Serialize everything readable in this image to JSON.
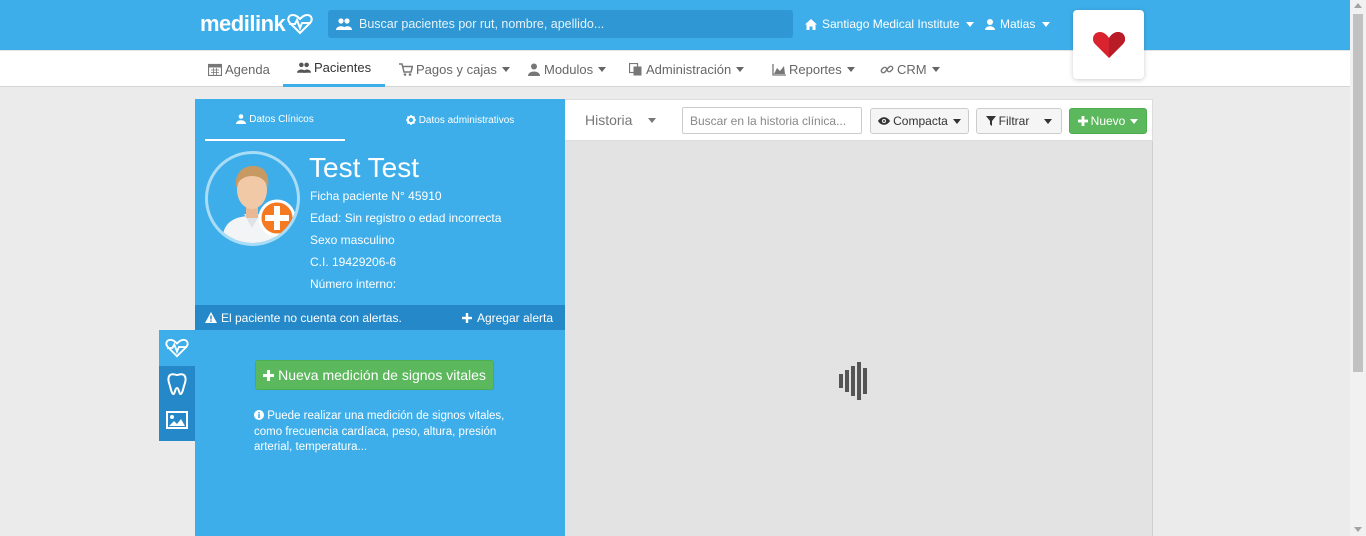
{
  "app": {
    "logo_text": "medilink",
    "search_placeholder": "Buscar pacientes por rut, nombre, apellido...",
    "clinic_name": "Santiago Medical Institute",
    "user_name": "Matias"
  },
  "nav": {
    "items": [
      {
        "label": "Agenda",
        "icon": "calendar-icon"
      },
      {
        "label": "Pacientes",
        "icon": "users-icon",
        "active": true
      },
      {
        "label": "Pagos y cajas",
        "icon": "cart-icon"
      },
      {
        "label": "Modulos",
        "icon": "user-md-icon"
      },
      {
        "label": "Administración",
        "icon": "copy-icon"
      },
      {
        "label": "Reportes",
        "icon": "area-chart-icon"
      },
      {
        "label": "CRM",
        "icon": "link-icon"
      }
    ]
  },
  "patient": {
    "tabs": {
      "clinical": "Datos Clínicos",
      "admin": "Datos administrativos"
    },
    "name": "Test Test",
    "record": "Ficha paciente N° 45910",
    "age": "Edad: Sin registro o edad incorrecta",
    "sex": "Sexo masculino",
    "id": "C.I. 19429206-6",
    "internal_number": "Número interno:",
    "alert_text": "El paciente no cuenta con alertas.",
    "add_alert": "Agregar alerta",
    "vitals_button": "Nueva medición de signos vitales",
    "vitals_info": "Puede realizar una medición de signos vitales, como frecuencia cardíaca, peso, altura, presión arterial, temperatura..."
  },
  "history": {
    "title": "Historia",
    "search_placeholder": "Buscar en la historia clínica...",
    "compact_label": "Compacta",
    "filter_label": "Filtrar",
    "new_label": "Nuevo"
  },
  "colors": {
    "primary": "#3daee9",
    "primary_dark": "#2588c8",
    "success": "#5cb85c",
    "heart": "#d9242f"
  }
}
